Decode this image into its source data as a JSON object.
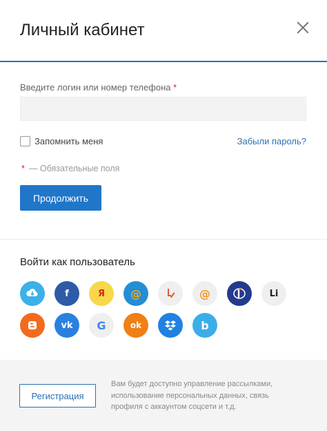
{
  "header": {
    "title": "Личный кабинет"
  },
  "login": {
    "label": "Введите логин или номер телефона",
    "required_mark": "*",
    "value": "",
    "placeholder": ""
  },
  "remember": {
    "label": "Запомнить меня",
    "checked": false
  },
  "forgot_link": "Забыли пароль?",
  "required_note": {
    "mark": "*",
    "text": "— Обязательные поля"
  },
  "continue_button": "Продолжить",
  "social": {
    "title": "Войти как пользователь",
    "row1": [
      {
        "name": "mailru-cloud",
        "glyph": "",
        "color": "#3bb1e8"
      },
      {
        "name": "facebook",
        "glyph": "f",
        "color": "#2e5aa8"
      },
      {
        "name": "yandex",
        "glyph": "Я",
        "color": "#f7d84a"
      },
      {
        "name": "mailru",
        "glyph": "@",
        "color": "#238ed6"
      },
      {
        "name": "livejournal",
        "glyph": "",
        "color": "#efefef"
      },
      {
        "name": "mail-at",
        "glyph": "@",
        "color": "#efefef"
      },
      {
        "name": "openid",
        "glyph": "",
        "color": "#243a8f"
      },
      {
        "name": "liveinternet",
        "glyph": "Li",
        "color": "#efefef"
      }
    ],
    "row2": [
      {
        "name": "blogger",
        "glyph": "B",
        "color": "#f26b1d"
      },
      {
        "name": "vkontakte",
        "glyph": "vk",
        "color": "#2a80e0"
      },
      {
        "name": "google",
        "glyph": "G",
        "color": "#efefef"
      },
      {
        "name": "odnoklassniki",
        "glyph": "ok",
        "color": "#f07f14"
      },
      {
        "name": "dropbox",
        "glyph": "",
        "color": "#2081e2"
      },
      {
        "name": "bitrix24",
        "glyph": "b",
        "color": "#3baee8"
      }
    ]
  },
  "footer": {
    "register_button": "Регистрация",
    "lines": [
      "Вам будет доступно управление рассылками,",
      "использование персональных данных, связь",
      "профиля с аккаунтом соцсети и т.д."
    ]
  }
}
